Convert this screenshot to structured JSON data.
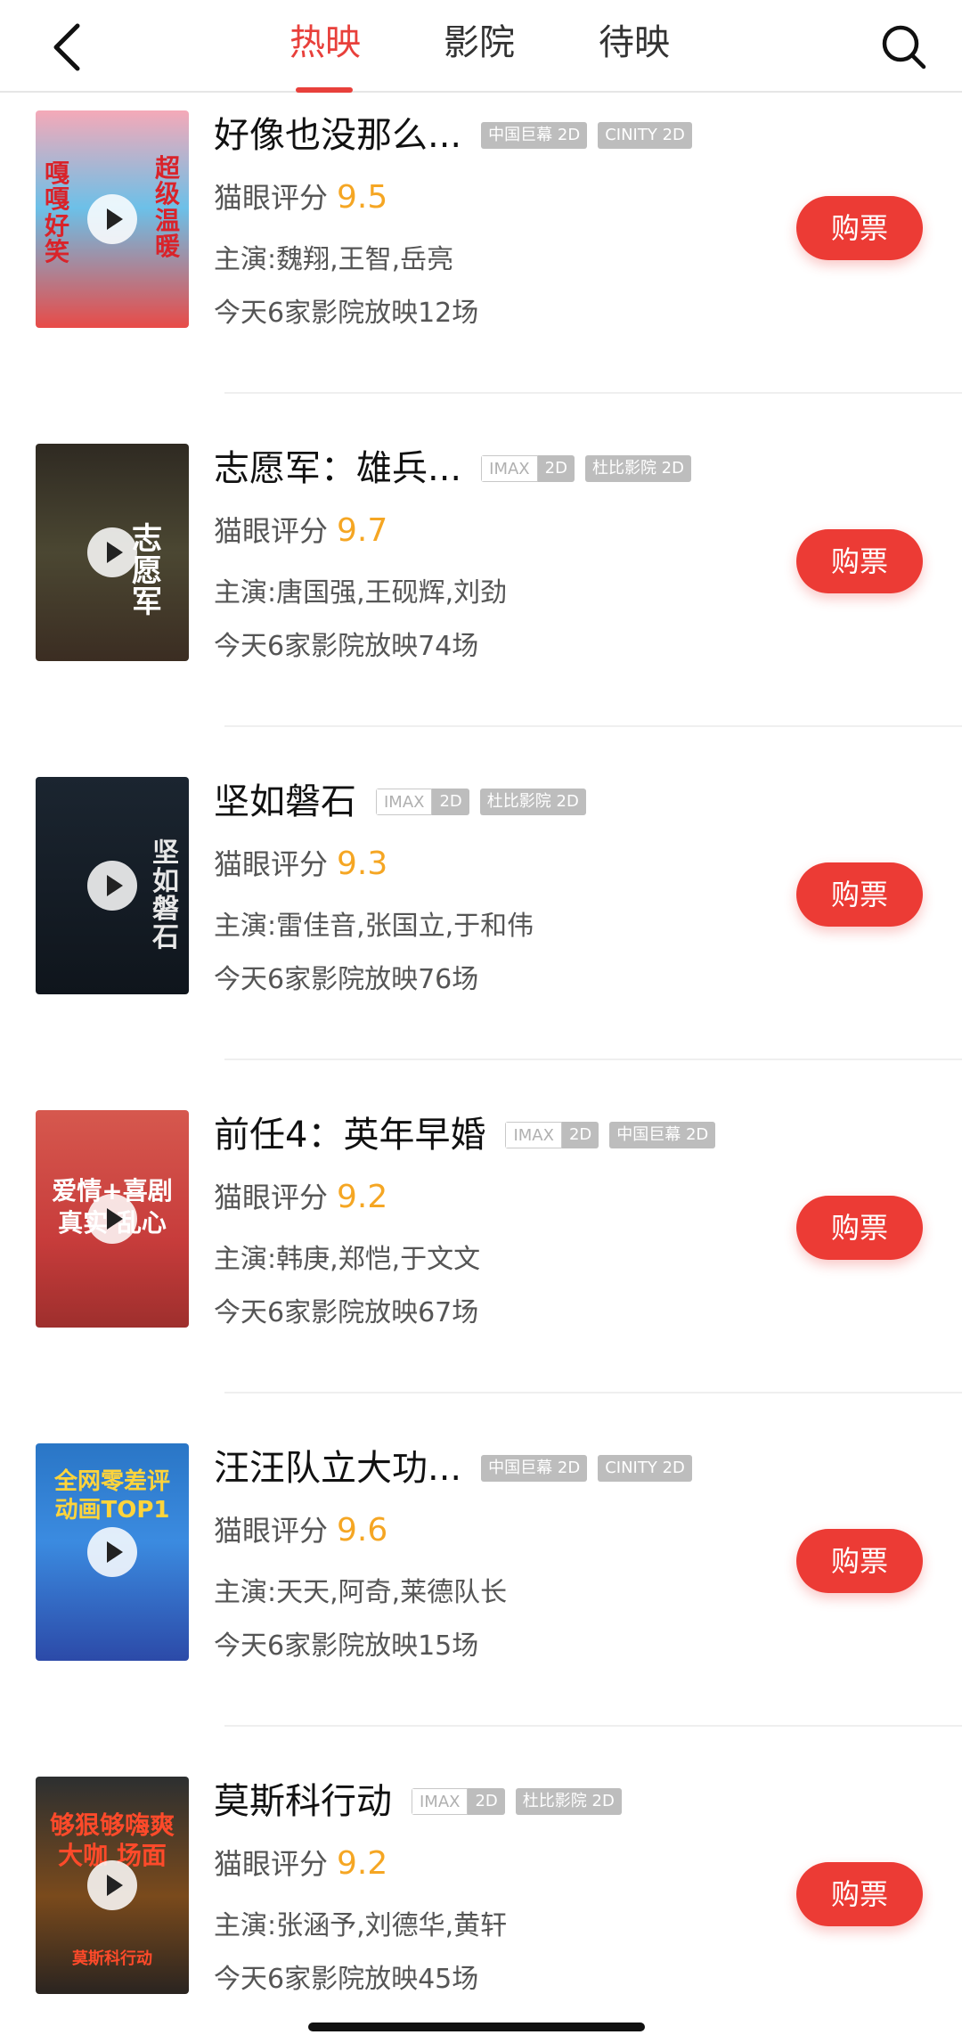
{
  "header": {
    "tabs": [
      {
        "label": "热映",
        "active": true
      },
      {
        "label": "影院",
        "active": false
      },
      {
        "label": "待映",
        "active": false
      }
    ],
    "back_icon": "chevron-left-icon",
    "search_icon": "search-icon",
    "accent_color": "#e8403b"
  },
  "movies": [
    {
      "title": "好像也没那么...",
      "tags": [
        {
          "type": "solid",
          "text": "中国巨幕 2D"
        },
        {
          "type": "solid",
          "text": "CINITY 2D"
        }
      ],
      "rating_label": "猫眼评分",
      "rating": "9.5",
      "cast": "主演:魏翔,王智,岳亮",
      "shows": "今天6家影院放映12场",
      "buy_label": "购票",
      "poster_text": [
        "嘎嘎好笑",
        "超级温暖"
      ]
    },
    {
      "title": "志愿军：雄兵...",
      "tags": [
        {
          "type": "split",
          "left": "IMAX",
          "right": "2D"
        },
        {
          "type": "solid",
          "text": "杜比影院 2D"
        }
      ],
      "rating_label": "猫眼评分",
      "rating": "9.7",
      "cast": "主演:唐国强,王砚辉,刘劲",
      "shows": "今天6家影院放映74场",
      "buy_label": "购票",
      "poster_text": [
        "志愿军"
      ]
    },
    {
      "title": "坚如磐石",
      "tags": [
        {
          "type": "split",
          "left": "IMAX",
          "right": "2D"
        },
        {
          "type": "solid",
          "text": "杜比影院 2D"
        }
      ],
      "rating_label": "猫眼评分",
      "rating": "9.3",
      "cast": "主演:雷佳音,张国立,于和伟",
      "shows": "今天6家影院放映76场",
      "buy_label": "购票",
      "poster_text": [
        "坚如磐石"
      ]
    },
    {
      "title": "前任4：英年早婚",
      "tags": [
        {
          "type": "split",
          "left": "IMAX",
          "right": "2D"
        },
        {
          "type": "solid",
          "text": "中国巨幕 2D"
        }
      ],
      "rating_label": "猫眼评分",
      "rating": "9.2",
      "cast": "主演:韩庚,郑恺,于文文",
      "shows": "今天6家影院放映67场",
      "buy_label": "购票",
      "poster_text": [
        "爱情+喜剧",
        "真实 乱心"
      ]
    },
    {
      "title": "汪汪队立大功...",
      "tags": [
        {
          "type": "solid",
          "text": "中国巨幕 2D"
        },
        {
          "type": "solid",
          "text": "CINITY 2D"
        }
      ],
      "rating_label": "猫眼评分",
      "rating": "9.6",
      "cast": "主演:天天,阿奇,莱德队长",
      "shows": "今天6家影院放映15场",
      "buy_label": "购票",
      "poster_text": [
        "全网零差评",
        "动画TOP1"
      ]
    },
    {
      "title": "莫斯科行动",
      "tags": [
        {
          "type": "split",
          "left": "IMAX",
          "right": "2D"
        },
        {
          "type": "solid",
          "text": "杜比影院 2D"
        }
      ],
      "rating_label": "猫眼评分",
      "rating": "9.2",
      "cast": "主演:张涵予,刘德华,黄轩",
      "shows": "今天6家影院放映45场",
      "buy_label": "购票",
      "poster_text": [
        "够狠够嗨爽",
        "大咖 场面",
        "莫斯科行动"
      ]
    }
  ],
  "colors": {
    "buy_button": "#ec3b35",
    "rating": "#f5a623",
    "tag_bg": "#bdbdbd"
  }
}
